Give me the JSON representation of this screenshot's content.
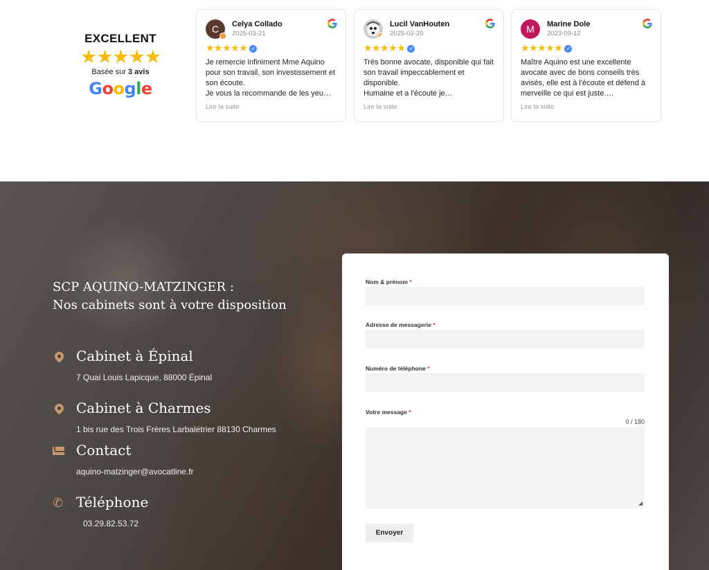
{
  "summary": {
    "rating_label": "EXCELLENT",
    "stars": "★★★★★",
    "based_prefix": "Basée sur ",
    "based_count": "3 avis",
    "google_letters": [
      "G",
      "o",
      "o",
      "g",
      "l",
      "e"
    ]
  },
  "reviews": [
    {
      "initial": "C",
      "name": "Celya Collado",
      "date": "2025-03-21",
      "stars": "★★★★★",
      "text": "Je remercie infiniment Mme Aquino pour son travail, son investissement et son écoute.\nJe vous la recommande de les yeu…",
      "read_more": "Lire la suite"
    },
    {
      "initial": "",
      "name": "Lucil VanHouten",
      "date": "2025-02-20",
      "stars": "★★★★★",
      "text": "Très bonne avocate, disponible qui fait son travail impeccablement et disponible.\nHumaine et a l'écoute je…",
      "read_more": "Lire la suite"
    },
    {
      "initial": "M",
      "name": "Marine Dole",
      "date": "2023-09-12",
      "stars": "★★★★★",
      "text": "Maître Aquino est une excellente avocate avec de bons conseils très avisés, elle est à l'écoute et défend à merveille ce qui est juste.…",
      "read_more": "Lire la suite"
    }
  ],
  "contact": {
    "title_line1": "SCP AQUINO-MATZINGER :",
    "title_line2": "Nos cabinets sont à votre disposition",
    "offices": [
      {
        "icon": "map-pin-icon",
        "heading": "Cabinet à Épinal",
        "detail": "7 Quai Louis Lapicque, 88000 Épinal"
      },
      {
        "icon": "map-pin-icon",
        "heading": "Cabinet à Charmes",
        "detail": "1 bis rue des Trois Frères Larbalétrier 88130 Charmes"
      },
      {
        "icon": "envelope-icon",
        "heading": "Contact",
        "detail": "aquino-matzinger@avocatline.fr"
      },
      {
        "icon": "phone-icon",
        "heading": "Téléphone",
        "detail": "03.29.82.53.72"
      }
    ]
  },
  "form": {
    "name_label": "Nom & prénom",
    "email_label": "Adresse de messagerie",
    "phone_label": "Numéro de téléphone",
    "message_label": "Votre message",
    "required_mark": "*",
    "name_value": "",
    "email_value": "",
    "phone_value": "",
    "message_value": "",
    "counter": "0 / 180",
    "submit_label": "Envoyer"
  },
  "colors": {
    "star": "#f6bb06",
    "accent": "#c79a72",
    "verified": "#4a8cf0",
    "required": "#d23b3b"
  }
}
